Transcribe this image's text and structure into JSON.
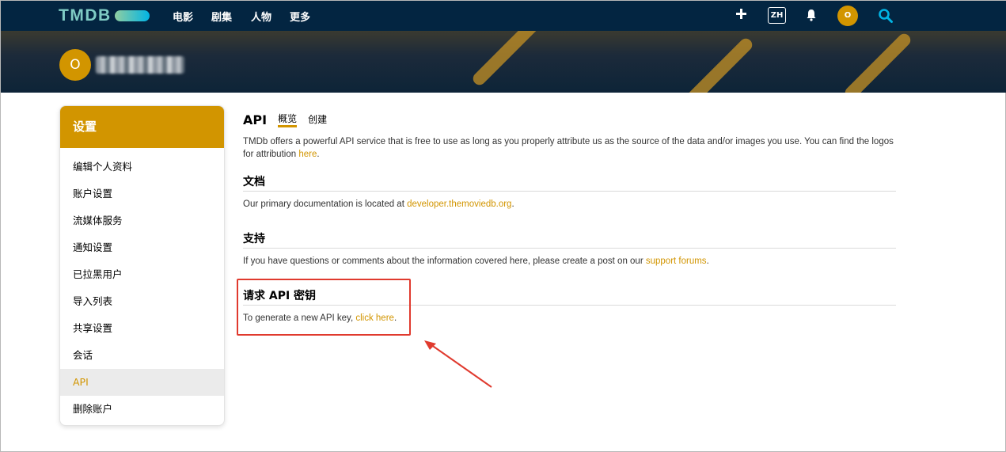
{
  "nav": {
    "logo": "TMDB",
    "links": [
      "电影",
      "剧集",
      "人物",
      "更多"
    ],
    "lang": "ZH",
    "avatar_initial": "O"
  },
  "banner": {
    "avatar_initial": "O"
  },
  "sidebar": {
    "title": "设置",
    "items": [
      {
        "label": "编辑个人资料"
      },
      {
        "label": "账户设置"
      },
      {
        "label": "流媒体服务"
      },
      {
        "label": "通知设置"
      },
      {
        "label": "已拉黑用户"
      },
      {
        "label": "导入列表"
      },
      {
        "label": "共享设置"
      },
      {
        "label": "会话"
      },
      {
        "label": "API"
      },
      {
        "label": "删除账户"
      }
    ]
  },
  "main": {
    "title": "API",
    "tabs": [
      {
        "label": "概览"
      },
      {
        "label": "创建"
      }
    ],
    "intro_text": "TMDb offers a powerful API service that is free to use as long as you properly attribute us as the source of the data and/or images you use. You can find the logos for attribution ",
    "intro_link": "here",
    "docs": {
      "heading": "文档",
      "text": "Our primary documentation is located at ",
      "link": "developer.themoviedb.org"
    },
    "support": {
      "heading": "支持",
      "text": "If you have questions or comments about the information covered here, please create a post on our ",
      "link": "support forums"
    },
    "request": {
      "heading": "请求 API 密钥",
      "text": "To generate a new API key, ",
      "link": "click here"
    }
  },
  "colors": {
    "nav_bg": "#032541",
    "accent": "#d29500",
    "annotation": "#e03a2e"
  }
}
